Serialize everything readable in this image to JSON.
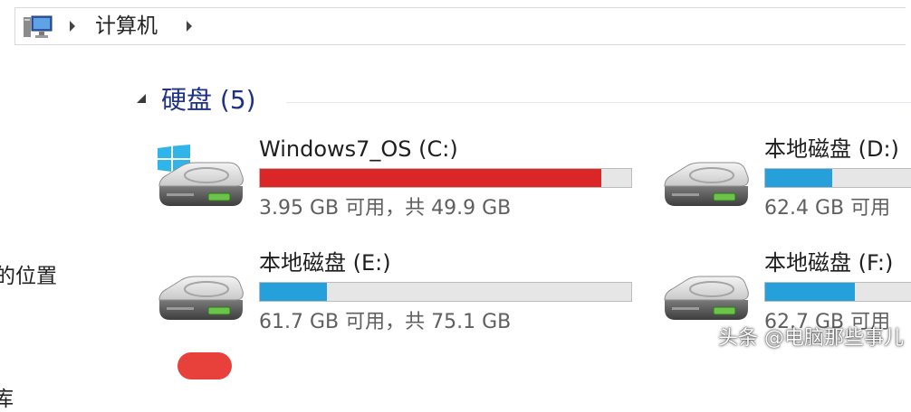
{
  "address_bar": {
    "location_icon": "computer-icon",
    "crumbs": [
      "计算机"
    ]
  },
  "nav_pane": {
    "items": [
      "的位置",
      "库"
    ]
  },
  "group": {
    "title": "硬盘 (5)",
    "collapse_icon": "collapse-triangle-icon"
  },
  "drives": [
    {
      "name": "Windows7_OS (C:)",
      "free_text": "3.95 GB 可用，共 49.9 GB",
      "used_fraction": 0.92,
      "bar_color": "#da2626",
      "icon": "system-drive-icon"
    },
    {
      "name": "本地磁盘 (D:)",
      "free_text": "62.4 GB 可用",
      "used_fraction": 0.18,
      "bar_color": "#26a0da",
      "icon": "hard-drive-icon"
    },
    {
      "name": "本地磁盘 (E:)",
      "free_text": "61.7 GB 可用，共 75.1 GB",
      "used_fraction": 0.18,
      "bar_color": "#26a0da",
      "icon": "hard-drive-icon"
    },
    {
      "name": "本地磁盘 (F:)",
      "free_text": "62.7 GB 可用",
      "used_fraction": 0.24,
      "bar_color": "#26a0da",
      "icon": "hard-drive-icon"
    }
  ],
  "watermark": "头条 @电脑那些事儿"
}
